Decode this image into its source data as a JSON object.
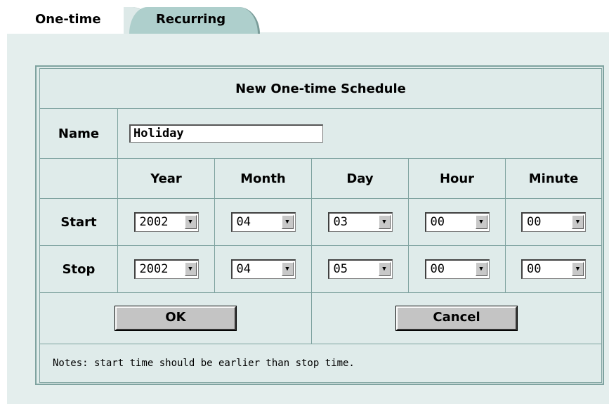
{
  "tabs": {
    "one_time": "One-time",
    "recurring": "Recurring"
  },
  "form": {
    "title": "New One-time Schedule",
    "name_label": "Name",
    "name_value": "Holiday",
    "columns": [
      "Year",
      "Month",
      "Day",
      "Hour",
      "Minute"
    ],
    "start_label": "Start",
    "stop_label": "Stop",
    "start": [
      "2002",
      "04",
      "03",
      "00",
      "00"
    ],
    "stop": [
      "2002",
      "04",
      "05",
      "00",
      "00"
    ],
    "ok_label": "OK",
    "cancel_label": "Cancel",
    "notes": "Notes: start time should be earlier than stop time."
  },
  "colors": {
    "panel": "#e4eeed",
    "border": "#7fa3a0",
    "tab_inactive": "#aecfcc"
  }
}
